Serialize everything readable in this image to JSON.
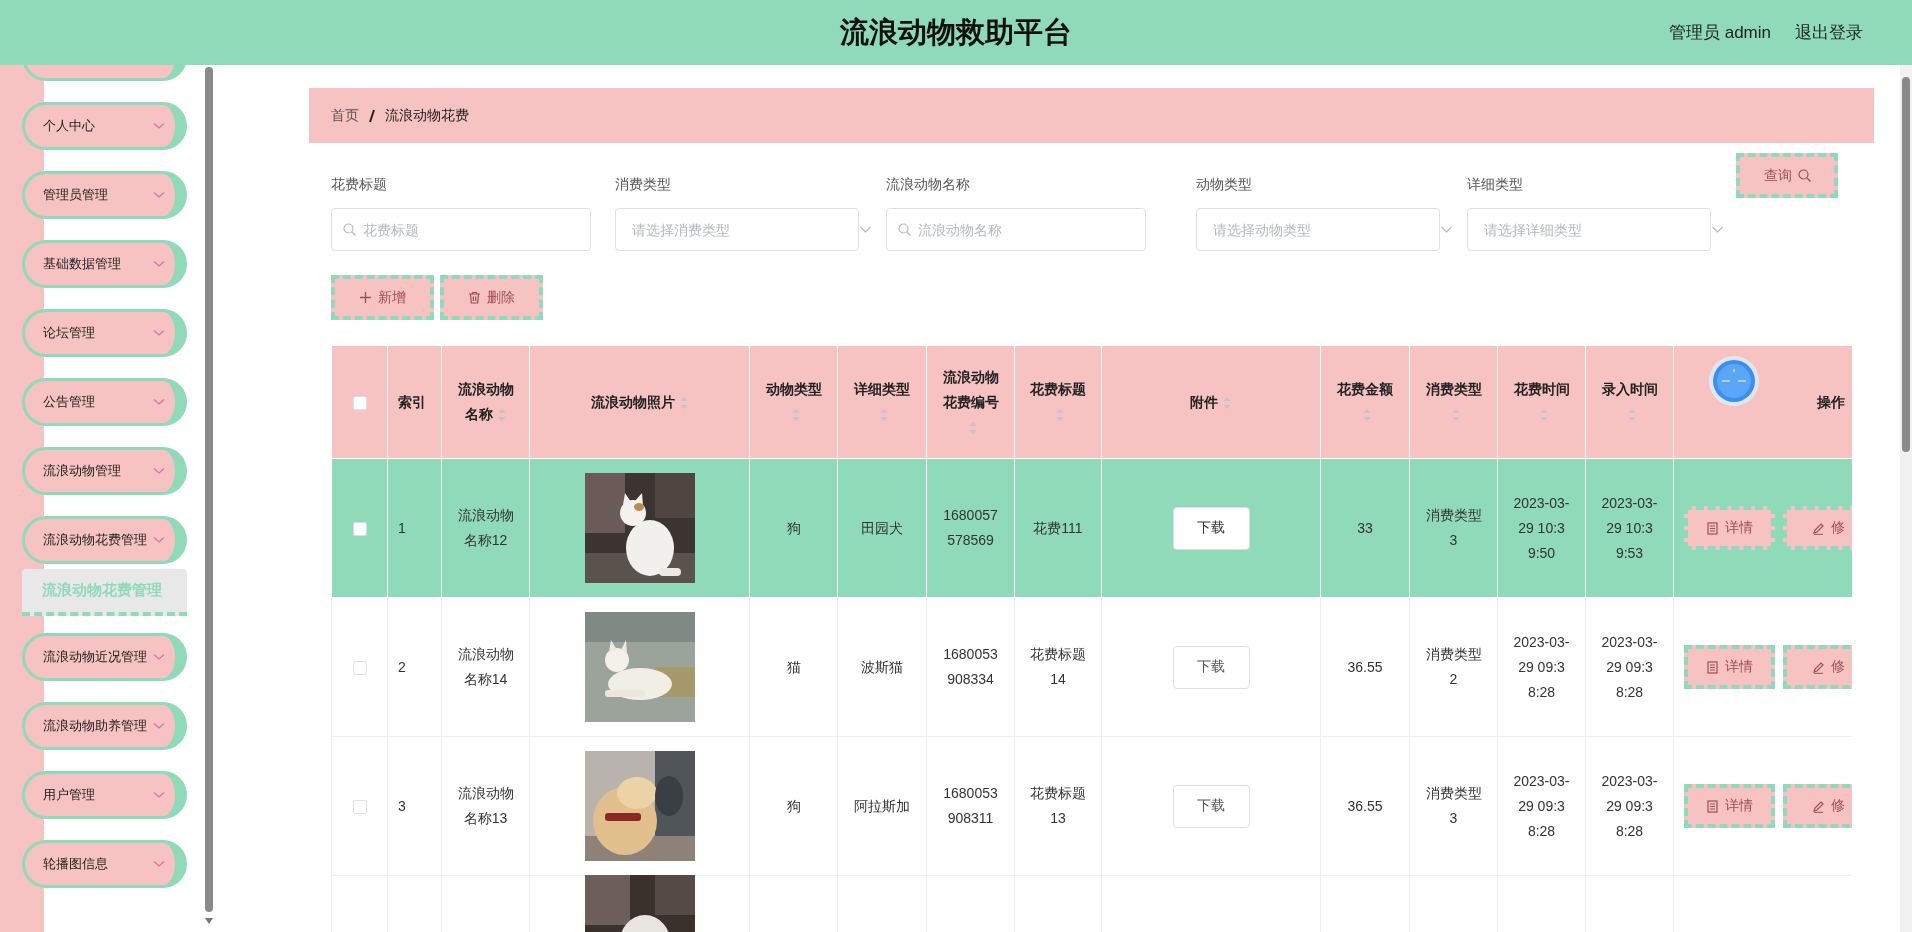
{
  "header": {
    "title": "流浪动物救助平台",
    "user": "管理员 admin",
    "logout": "退出登录"
  },
  "sidebar": {
    "items": [
      {
        "label": "个人中心"
      },
      {
        "label": "管理员管理"
      },
      {
        "label": "基础数据管理"
      },
      {
        "label": "论坛管理"
      },
      {
        "label": "公告管理"
      },
      {
        "label": "流浪动物管理"
      },
      {
        "label": "流浪动物花费管理",
        "children": [
          {
            "label": "流浪动物花费管理",
            "selected": true
          }
        ]
      },
      {
        "label": "流浪动物近况管理"
      },
      {
        "label": "流浪动物助养管理"
      },
      {
        "label": "用户管理"
      },
      {
        "label": "轮播图信息"
      }
    ]
  },
  "breadcrumb": [
    "首页",
    "流浪动物花费"
  ],
  "filters": [
    {
      "label": "花费标题",
      "kind": "search",
      "placeholder": "花费标题"
    },
    {
      "label": "消费类型",
      "kind": "select",
      "placeholder": "请选择消费类型"
    },
    {
      "label": "流浪动物名称",
      "kind": "search",
      "placeholder": "流浪动物名称"
    },
    {
      "label": "动物类型",
      "kind": "select",
      "placeholder": "请选择动物类型"
    },
    {
      "label": "详细类型",
      "kind": "select",
      "placeholder": "请选择详细类型"
    }
  ],
  "search_button": "查询",
  "actions": [
    {
      "kind": "add",
      "label": "新增"
    },
    {
      "kind": "delete",
      "label": "删除"
    }
  ],
  "table": {
    "columns": [
      {
        "kind": "checkbox",
        "checked": false
      },
      {
        "kind": "text",
        "label": "索引",
        "sortable": false
      },
      {
        "kind": "text",
        "label": "流浪动物名称",
        "sortable": true
      },
      {
        "kind": "text",
        "label": "流浪动物照片",
        "sortable": true
      },
      {
        "kind": "text",
        "label": "动物类型",
        "sortable": true
      },
      {
        "kind": "text",
        "label": "详细类型",
        "sortable": true
      },
      {
        "kind": "text",
        "label": "流浪动物花费编号",
        "sortable": true
      },
      {
        "kind": "text",
        "label": "花费标题",
        "sortable": true
      },
      {
        "kind": "text",
        "label": "附件",
        "sortable": true
      },
      {
        "kind": "text",
        "label": "花费金额",
        "sortable": true
      },
      {
        "kind": "text",
        "label": "消费类型",
        "sortable": true
      },
      {
        "kind": "text",
        "label": "花费时间",
        "sortable": true
      },
      {
        "kind": "text",
        "label": "录入时间",
        "sortable": true
      },
      {
        "kind": "text",
        "label": "操作",
        "sortable": false
      }
    ],
    "rows": [
      {
        "selected": true,
        "checked": false,
        "index": "1",
        "name": "流浪动物名称12",
        "animal_type": "狗",
        "detail_type": "田园犬",
        "number": "1680057578569",
        "title": "花费111",
        "attachment": "下载",
        "amount": "33",
        "spend_type": "消费类型3",
        "spend_time": "2023-03-29 10:39:50",
        "entry_time": "2023-03-29 10:39:53",
        "buttons": [
          {
            "kind": "detail",
            "label": "详情"
          },
          {
            "kind": "edit",
            "label": "修"
          }
        ]
      },
      {
        "selected": false,
        "checked": false,
        "index": "2",
        "name": "流浪动物名称14",
        "animal_type": "猫",
        "detail_type": "波斯猫",
        "number": "1680053908334",
        "title": "花费标题14",
        "attachment": "下载",
        "amount": "36.55",
        "spend_type": "消费类型2",
        "spend_time": "2023-03-29 09:38:28",
        "entry_time": "2023-03-29 09:38:28",
        "buttons": [
          {
            "kind": "detail",
            "label": "详情"
          },
          {
            "kind": "edit",
            "label": "修"
          }
        ]
      },
      {
        "selected": false,
        "checked": false,
        "index": "3",
        "name": "流浪动物名称13",
        "animal_type": "狗",
        "detail_type": "阿拉斯加",
        "number": "1680053908311",
        "title": "花费标题13",
        "attachment": "下载",
        "amount": "36.55",
        "spend_type": "消费类型3",
        "spend_time": "2023-03-29 09:38:28",
        "entry_time": "2023-03-29 09:38:28",
        "buttons": [
          {
            "kind": "detail",
            "label": "详情"
          },
          {
            "kind": "edit",
            "label": "修"
          }
        ]
      },
      {
        "selected": false
      }
    ]
  }
}
